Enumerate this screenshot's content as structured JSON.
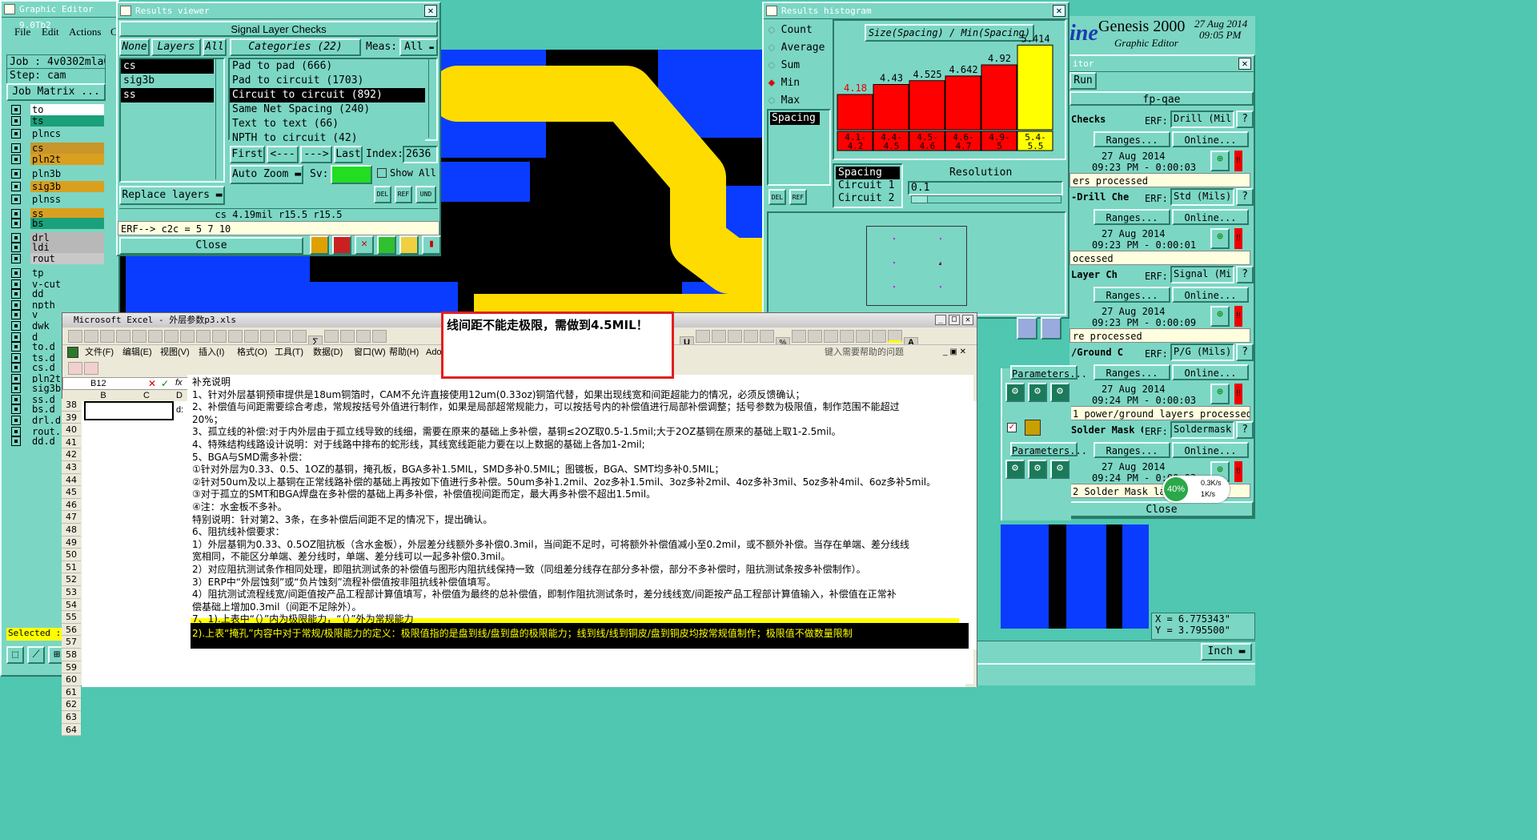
{
  "main": {
    "title": "Graphic Editor 9.0Tb2",
    "menu": [
      "File",
      "Edit",
      "Actions",
      "C"
    ],
    "job_label": "Job : 4v0302mla0",
    "step_label": "Step: cam",
    "job_matrix_btn": "Job Matrix ...",
    "layers": [
      {
        "name": "to",
        "bg": "#ffffff"
      },
      {
        "name": "ts",
        "bg": "#1aa07a"
      },
      {
        "name": "plncs",
        "bg": "#7cd6c4"
      },
      {
        "name": "cs",
        "bg": "#c8962a"
      },
      {
        "name": "pln2t",
        "bg": "#d9a020"
      },
      {
        "name": "pln3b",
        "bg": "#7cd6c4"
      },
      {
        "name": "sig3b",
        "bg": "#d9a020"
      },
      {
        "name": "plnss",
        "bg": "#7cd6c4"
      },
      {
        "name": "ss",
        "bg": "#d9a020"
      },
      {
        "name": "bs",
        "bg": "#1aa07a"
      },
      {
        "name": "drl",
        "bg": "#b8b8b8"
      },
      {
        "name": "ldi",
        "bg": "#b8b8b8"
      },
      {
        "name": "rout",
        "bg": "#c8c8c8"
      },
      {
        "name": "tp",
        "bg": "#7cd6c4"
      },
      {
        "name": "v-cut",
        "bg": "#7cd6c4"
      },
      {
        "name": "dd",
        "bg": "#7cd6c4"
      },
      {
        "name": "npth",
        "bg": "#7cd6c4"
      },
      {
        "name": "v",
        "bg": "#7cd6c4"
      },
      {
        "name": "dwk",
        "bg": "#7cd6c4"
      },
      {
        "name": "d",
        "bg": "#7cd6c4"
      },
      {
        "name": "to.d",
        "bg": "#7cd6c4"
      },
      {
        "name": "ts.d",
        "bg": "#7cd6c4"
      },
      {
        "name": "cs.d",
        "bg": "#7cd6c4"
      },
      {
        "name": "pln2t.",
        "bg": "#7cd6c4"
      },
      {
        "name": "sig3b.",
        "bg": "#7cd6c4"
      },
      {
        "name": "ss.d",
        "bg": "#7cd6c4"
      },
      {
        "name": "bs.d",
        "bg": "#7cd6c4"
      },
      {
        "name": "drl.d",
        "bg": "#7cd6c4"
      },
      {
        "name": "rout.d",
        "bg": "#7cd6c4"
      },
      {
        "name": "dd.d",
        "bg": "#7cd6c4"
      }
    ],
    "selected_label": "Selected :",
    "coords": {
      "x": "X = 6.775343\"",
      "y": "Y = 3.795500\""
    },
    "units": "Inch",
    "brand": {
      "logo": "ine",
      "name": "Genesis 2000",
      "sub": "Graphic Editor",
      "date": "27 Aug 2014",
      "time": "09:05 PM"
    }
  },
  "results_viewer": {
    "title": "Results viewer",
    "header": "Signal Layer Checks",
    "none_btn": "None",
    "layers_label": "Layers",
    "all_btn": "All",
    "categories_label": "Categories (22)",
    "meas_label": "Meas:",
    "meas_value": "All",
    "layers": [
      "cs",
      "sig3b",
      "ss"
    ],
    "categories": [
      "Pad to pad (666)",
      "Pad to circuit (1703)",
      "Circuit to circuit (892)",
      "Same Net Spacing (240)",
      "Text to text (66)",
      "NPTH to circuit (42)"
    ],
    "first": "First",
    "prev": "<---",
    "next": "--->",
    "last": "Last",
    "index_label": "Index:",
    "index_value": "2636",
    "auto_zoom": "Auto Zoom",
    "sv_label": "Sv:",
    "show_all": "Show All",
    "replace_layers": "Replace layers",
    "status": "cs 4.19mil  r15.5  r15.5",
    "erf": "ERF--> c2c = 5 7 10",
    "close": "Close"
  },
  "histogram": {
    "title": "Results histogram",
    "modes": [
      "Count",
      "Average",
      "Sum",
      "Min",
      "Max"
    ],
    "active_mode": "Min",
    "list_item": "Spacing",
    "chart_title": "Size(Spacing) / Min(Spacing)",
    "resolution_label": "Resolution",
    "resolution_value": "0.1",
    "measures": [
      "Spacing",
      "Circuit 1",
      "Circuit 2"
    ]
  },
  "chart_data": {
    "type": "bar",
    "title": "Size(Spacing) / Min(Spacing)",
    "categories": [
      "4.1-4.2",
      "4.4-4.5",
      "4.5-4.6",
      "4.6-4.7",
      "4.9-5",
      "5.4-5.5"
    ],
    "values": [
      4.18,
      4.43,
      4.525,
      4.642,
      4.92,
      5.414
    ],
    "value_labels": [
      "4.18",
      "4.43",
      "4.525",
      "4.642",
      "4.92",
      "5.414"
    ],
    "bar_colors": [
      "#ff0000",
      "#ff0000",
      "#ff0000",
      "#ff0000",
      "#ff0000",
      "#ffff00"
    ],
    "ylim": [
      0,
      5.5
    ]
  },
  "checklist": {
    "title": "itor",
    "run": "Run",
    "name": "fp-qae",
    "erf_label": "ERF:",
    "ranges": "Ranges...",
    "online": "Online...",
    "parameters": "Parameters...",
    "close": "Close",
    "items": [
      {
        "name": "Checks",
        "erf": "Drill (Mil",
        "date": "27 Aug 2014",
        "time": "09:23 PM - 0:00:03",
        "status": "ers processed"
      },
      {
        "name": "-Drill Che",
        "erf": "Std (Mils)",
        "date": "27 Aug 2014",
        "time": "09:23 PM - 0:00:01",
        "status": "ocessed"
      },
      {
        "name": "Layer Ch",
        "erf": "Signal (Mi",
        "date": "27 Aug 2014",
        "time": "09:23 PM - 0:00:09",
        "status": "re processed"
      },
      {
        "name": "/Ground C",
        "erf": "P/G (Mils)",
        "date": "27 Aug 2014",
        "time": "09:24 PM - 0:00:03",
        "status": "1 power/ground layers processed"
      },
      {
        "name": "Solder Mask Ch",
        "erf": "Soldermask",
        "date": "27 Aug 2014",
        "time": "09:24 PM - 0:00:03",
        "status": "2 Solder Mask layers were p"
      }
    ],
    "net": {
      "percent": "40%",
      "up": "0.3K/s",
      "down": "1K/s"
    }
  },
  "excel": {
    "title": "Microsoft Excel - 外层参数p3.xls",
    "menu": [
      "文件(F)",
      "编辑(E)",
      "视图(V)",
      "插入(I)",
      "格式(O)",
      "工具(T)",
      "数据(D)",
      "窗口(W)",
      "帮助(H)",
      "Adob"
    ],
    "help_placeholder": "键入需要帮助的问题",
    "name_box": "B12",
    "fx": "fx",
    "columns": [
      "B",
      "C",
      "D"
    ],
    "cell_d": "d:",
    "rows": [
      "38",
      "39",
      "40",
      "41",
      "42",
      "43",
      "44",
      "45",
      "46",
      "47",
      "48",
      "49",
      "50",
      "51",
      "52",
      "53",
      "54",
      "55",
      "56",
      "57",
      "58",
      "59",
      "60",
      "61",
      "62",
      "63",
      "64"
    ]
  },
  "callout": "线间距不能走极限，需做到4.5MIL！",
  "notes": [
    "补充说明",
    "1、针对外层基铜预审提供是18um铜箔时，CAM不允许直接使用12um(0.33oz)铜箔代替，如果出现线宽和间距超能力的情况，必须反馈确认；",
    "2、补偿值与间距需要综合考虑，常规按括号外值进行制作，如果是局部超常规能力，可以按括号内的补偿值进行局部补偿调整；括号参数为极限值，制作范围不能超过",
    "20%；",
    "3、孤立线的补偿:对于内外层由于孤立线导致的线细，需要在原来的基础上多补偿，基铜≤2OZ取0.5-1.5mil;大于2OZ基铜在原来的基础上取1-2.5mil。",
    "4、特殊结构线路设计说明：对于线路中排布的蛇形线，其线宽线距能力要在以上数据的基础上各加1-2mil;",
    "5、BGA与SMD需多补偿：",
    "①针对外层为0.33、0.5、1OZ的基铜，掩孔板，BGA多补1.5MIL，SMD多补0.5MIL；图镀板，BGA、SMT均多补0.5MIL；",
    "②针对50um及以上基铜在正常线路补偿的基础上再按如下值进行多补偿。50um多补1.2mil、2oz多补1.5mil、3oz多补2mil、4oz多补3mil、5oz多补4mil、6oz多补5mil。",
    "③对于孤立的SMT和BGA焊盘在多补偿的基础上再多补偿，补偿值视间距而定，最大再多补偿不超出1.5mil。",
    "④注：水金板不多补。",
    "特别说明：针对第2、3条，在多补偿后间距不足的情况下，提出确认。",
    "6、阻抗线补偿要求：",
    "1）外层基铜为0.33、0.5OZ阻抗板（含水金板），外层差分线额外多补偿0.3mil，当间距不足时，可将额外补偿值减小至0.2mil，或不额外补偿。当存在单端、差分线线",
    "宽相同，不能区分单端、差分线时，单端、差分线可以一起多补偿0.3mil。",
    "2）对应阻抗测试条作相同处理，即阻抗测试条的补偿值与图形内阻抗线保持一致（同组差分线存在部分多补偿，部分不多补偿时，阻抗测试条按多补偿制作）。",
    "3）ERP中“外层蚀刻”或“负片蚀刻”流程补偿值按非阻抗线补偿值填写。",
    "4）阻抗测试流程线宽/间距值按产品工程部计算值填写，补偿值为最终的总补偿值，即制作阻抗测试条时，差分线线宽/间距按产品工程部计算值输入，补偿值在正常补",
    "偿基础上增加0.3mil（间距不足除外）。",
    "7、1).上表中“（）”内为极限能力，“（）”外为常规能力",
    "    2).上表“掩孔”内容中对于常规/极限能力的定义：极限值指的是盘到线/盘到盘的极限能力；线到线/线到铜皮/盘到铜皮均按常规值制作；极限值不做数量限制"
  ]
}
